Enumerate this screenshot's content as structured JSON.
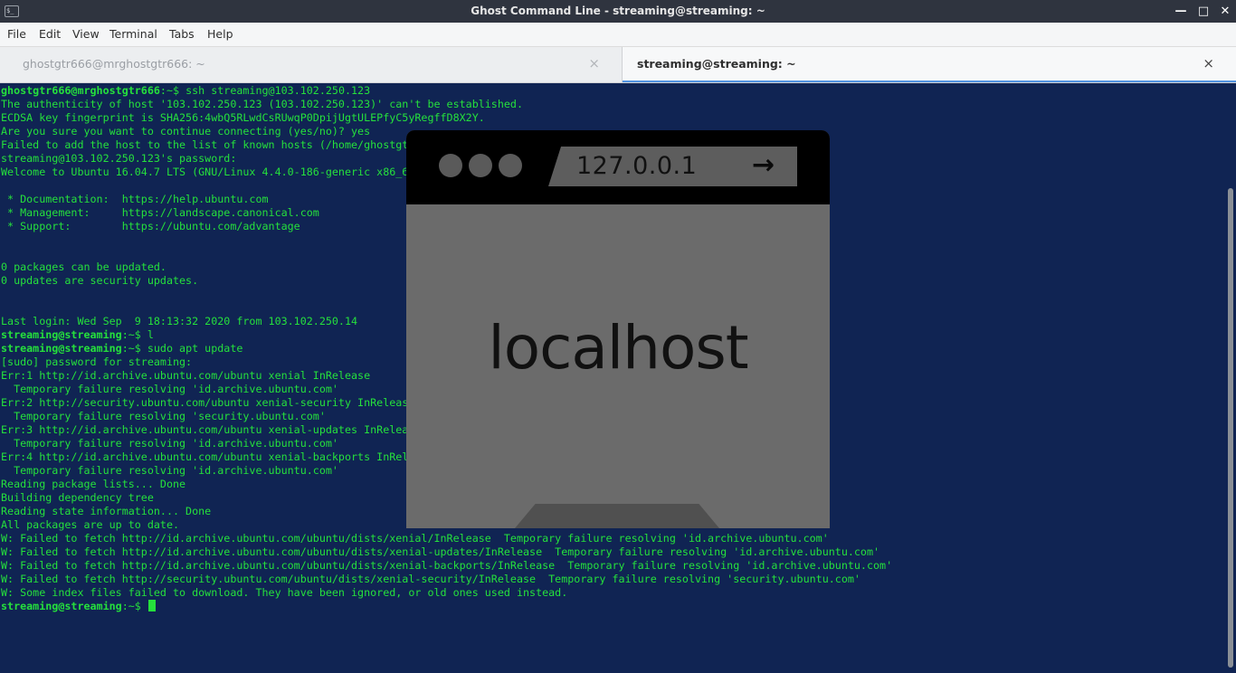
{
  "window": {
    "title": "Ghost Command Line - streaming@streaming: ~",
    "icon_text": "$_",
    "controls": {
      "minimize": "—",
      "maximize": "□",
      "close": "✕"
    }
  },
  "menu": [
    "File",
    "Edit",
    "View",
    "Terminal",
    "Tabs",
    "Help"
  ],
  "tabs": [
    {
      "label": "ghostgtr666@mrghostgtr666: ~",
      "close": "×",
      "active": false
    },
    {
      "label": "streaming@streaming: ~",
      "close": "×",
      "active": true
    }
  ],
  "terminal": {
    "colors": {
      "background": "#102453",
      "text": "#25e03c"
    },
    "lines": [
      {
        "prompt": "ghostgtr666@mrghostgtr666",
        "suffix": ":~$ ssh streaming@103.102.250.123"
      },
      {
        "text": "The authenticity of host '103.102.250.123 (103.102.250.123)' can't be established."
      },
      {
        "text": "ECDSA key fingerprint is SHA256:4wbQ5RLwdCsRUwqP0DpijUgtULEPfyC5yRegffD8X2Y."
      },
      {
        "text": "Are you sure you want to continue connecting (yes/no)? yes"
      },
      {
        "text": "Failed to add the host to the list of known hosts (/home/ghostgtr666/.ssh/known_hosts)."
      },
      {
        "text": "streaming@103.102.250.123's password:"
      },
      {
        "text": "Welcome to Ubuntu 16.04.7 LTS (GNU/Linux 4.4.0-186-generic x86_64)"
      },
      {
        "text": ""
      },
      {
        "text": " * Documentation:  https://help.ubuntu.com"
      },
      {
        "text": " * Management:     https://landscape.canonical.com"
      },
      {
        "text": " * Support:        https://ubuntu.com/advantage"
      },
      {
        "text": ""
      },
      {
        "text": ""
      },
      {
        "text": "0 packages can be updated."
      },
      {
        "text": "0 updates are security updates."
      },
      {
        "text": ""
      },
      {
        "text": ""
      },
      {
        "text": "Last login: Wed Sep  9 18:13:32 2020 from 103.102.250.14"
      },
      {
        "prompt": "streaming@streaming",
        "suffix": ":~$ l"
      },
      {
        "prompt": "streaming@streaming",
        "suffix": ":~$ sudo apt update"
      },
      {
        "text": "[sudo] password for streaming:"
      },
      {
        "text": "Err:1 http://id.archive.ubuntu.com/ubuntu xenial InRelease"
      },
      {
        "text": "  Temporary failure resolving 'id.archive.ubuntu.com'"
      },
      {
        "text": "Err:2 http://security.ubuntu.com/ubuntu xenial-security InRelease"
      },
      {
        "text": "  Temporary failure resolving 'security.ubuntu.com'"
      },
      {
        "text": "Err:3 http://id.archive.ubuntu.com/ubuntu xenial-updates InRelease"
      },
      {
        "text": "  Temporary failure resolving 'id.archive.ubuntu.com'"
      },
      {
        "text": "Err:4 http://id.archive.ubuntu.com/ubuntu xenial-backports InRelease"
      },
      {
        "text": "  Temporary failure resolving 'id.archive.ubuntu.com'"
      },
      {
        "text": "Reading package lists... Done"
      },
      {
        "text": "Building dependency tree"
      },
      {
        "text": "Reading state information... Done"
      },
      {
        "text": "All packages are up to date."
      },
      {
        "text": "W: Failed to fetch http://id.archive.ubuntu.com/ubuntu/dists/xenial/InRelease  Temporary failure resolving 'id.archive.ubuntu.com'"
      },
      {
        "text": "W: Failed to fetch http://id.archive.ubuntu.com/ubuntu/dists/xenial-updates/InRelease  Temporary failure resolving 'id.archive.ubuntu.com'"
      },
      {
        "text": "W: Failed to fetch http://id.archive.ubuntu.com/ubuntu/dists/xenial-backports/InRelease  Temporary failure resolving 'id.archive.ubuntu.com'"
      },
      {
        "text": "W: Failed to fetch http://security.ubuntu.com/ubuntu/dists/xenial-security/InRelease  Temporary failure resolving 'security.ubuntu.com'"
      },
      {
        "text": "W: Some index files failed to download. They have been ignored, or old ones used instead."
      },
      {
        "prompt": "streaming@streaming",
        "suffix": ":~$ ",
        "cursor": true
      }
    ]
  },
  "overlay": {
    "url": "127.0.0.1",
    "arrow": "→",
    "heading": "localhost"
  }
}
